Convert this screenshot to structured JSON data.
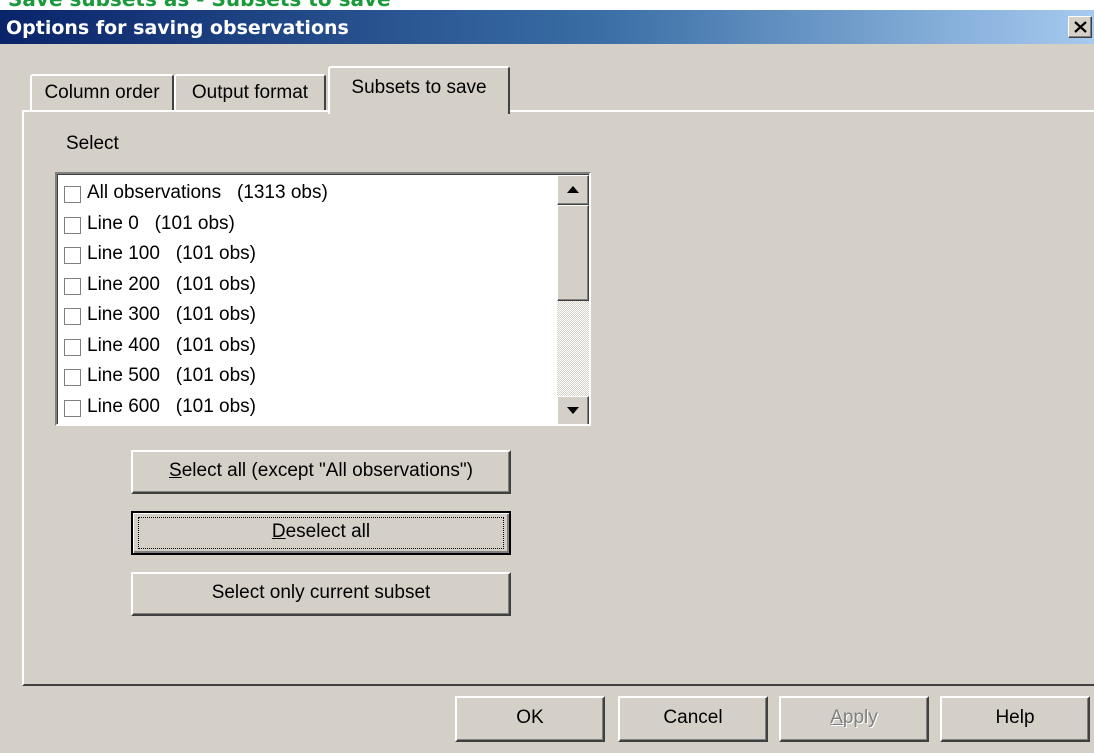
{
  "page_header": {
    "text": "Save subsets as - Subsets to save"
  },
  "window": {
    "title": "Options for saving observations",
    "close_icon": "close-x-icon"
  },
  "tabs": [
    {
      "label": "Column order",
      "active": false
    },
    {
      "label": "Output format",
      "active": false
    },
    {
      "label": "Subsets to save",
      "active": true
    }
  ],
  "panel": {
    "select_label": "Select",
    "list_items": [
      {
        "label": "All observations   (1313 obs)",
        "checked": false
      },
      {
        "label": "Line 0   (101 obs)",
        "checked": false
      },
      {
        "label": "Line 100   (101 obs)",
        "checked": false
      },
      {
        "label": "Line 200   (101 obs)",
        "checked": false
      },
      {
        "label": "Line 300   (101 obs)",
        "checked": false
      },
      {
        "label": "Line 400   (101 obs)",
        "checked": false
      },
      {
        "label": "Line 500   (101 obs)",
        "checked": false
      },
      {
        "label": "Line 600   (101 obs)",
        "checked": false
      }
    ],
    "buttons": {
      "select_all": {
        "mnemonic": "S",
        "rest": "elect all (except \"All observations\")"
      },
      "deselect_all": {
        "mnemonic": "D",
        "rest": "eselect all"
      },
      "select_current": {
        "label": "Select only current subset"
      }
    }
  },
  "footer": {
    "ok": "OK",
    "cancel": "Cancel",
    "apply": {
      "mnemonic": "A",
      "rest": "pply",
      "disabled": true
    },
    "help": "Help"
  },
  "colors": {
    "title_bar_start": "#0a246a",
    "title_bar_end": "#a6caf0",
    "header_text": "#1a9a3a",
    "face": "#d4d0c8"
  }
}
